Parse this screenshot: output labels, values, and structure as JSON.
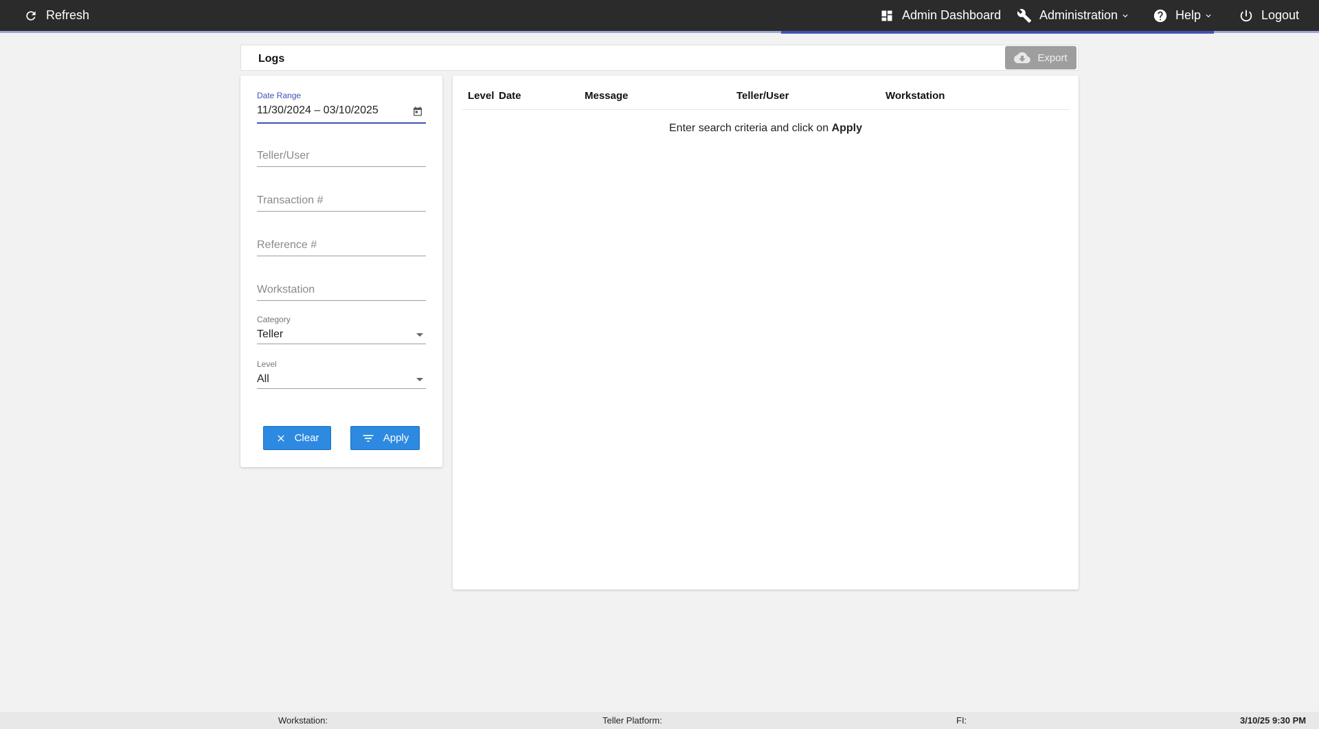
{
  "topbar": {
    "refresh_label": "Refresh",
    "dashboard_label": "Admin Dashboard",
    "administration_label": "Administration",
    "help_label": "Help",
    "logout_label": "Logout",
    "background": "#2b2b2b",
    "accent": "#3f51b5"
  },
  "logs": {
    "title": "Logs",
    "export_label": "Export"
  },
  "filters": {
    "date_range_label": "Date Range",
    "date_range_value": "11/30/2024 – 03/10/2025",
    "teller_user_placeholder": "Teller/User",
    "transaction_placeholder": "Transaction #",
    "reference_placeholder": "Reference #",
    "workstation_placeholder": "Workstation",
    "category_label": "Category",
    "category_value": "Teller",
    "level_label": "Level",
    "level_value": "All",
    "clear_label": "Clear",
    "apply_label": "Apply",
    "button_color": "#2d8ae0"
  },
  "results": {
    "columns": [
      "Level",
      "Date",
      "Message",
      "Teller/User",
      "Workstation"
    ],
    "empty_prefix": "Enter search criteria and click on ",
    "empty_action": "Apply"
  },
  "footer": {
    "workstation_label": "Workstation:",
    "teller_platform_label": "Teller Platform:",
    "fi_label": "FI:",
    "datetime": "3/10/25 9:30 PM"
  }
}
